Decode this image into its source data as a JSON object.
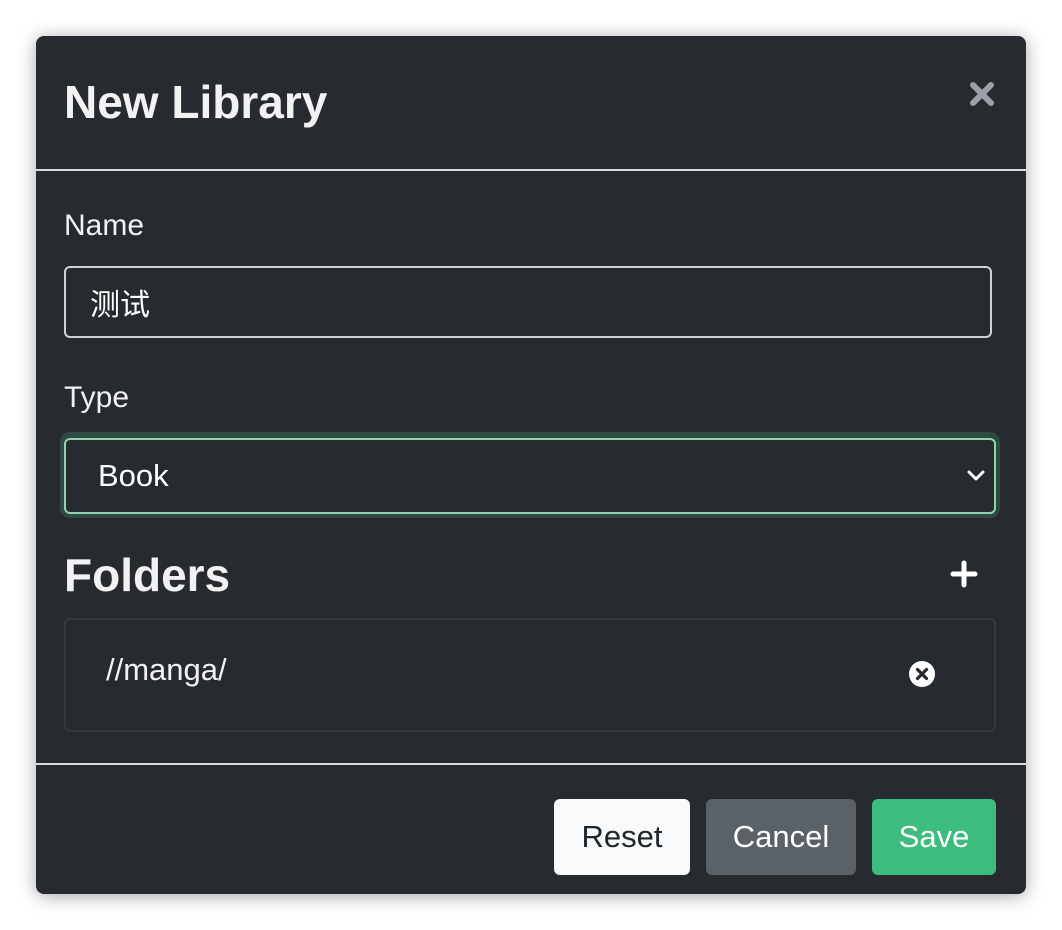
{
  "dialog": {
    "title": "New Library"
  },
  "form": {
    "name": {
      "label": "Name",
      "value": "测试"
    },
    "type": {
      "label": "Type",
      "selected": "Book"
    }
  },
  "folders": {
    "heading": "Folders",
    "items": [
      {
        "path": "//manga/"
      }
    ]
  },
  "footer": {
    "reset_label": "Reset",
    "cancel_label": "Cancel",
    "save_label": "Save"
  },
  "colors": {
    "background": "#272b30",
    "accent": "#3cbc7d",
    "secondary": "#5a6167",
    "focus_ring": "#8fd4b0"
  },
  "icons": {
    "close": "close-icon",
    "add": "plus-icon",
    "remove": "remove-circle-icon",
    "select": "chevron-down-icon"
  }
}
